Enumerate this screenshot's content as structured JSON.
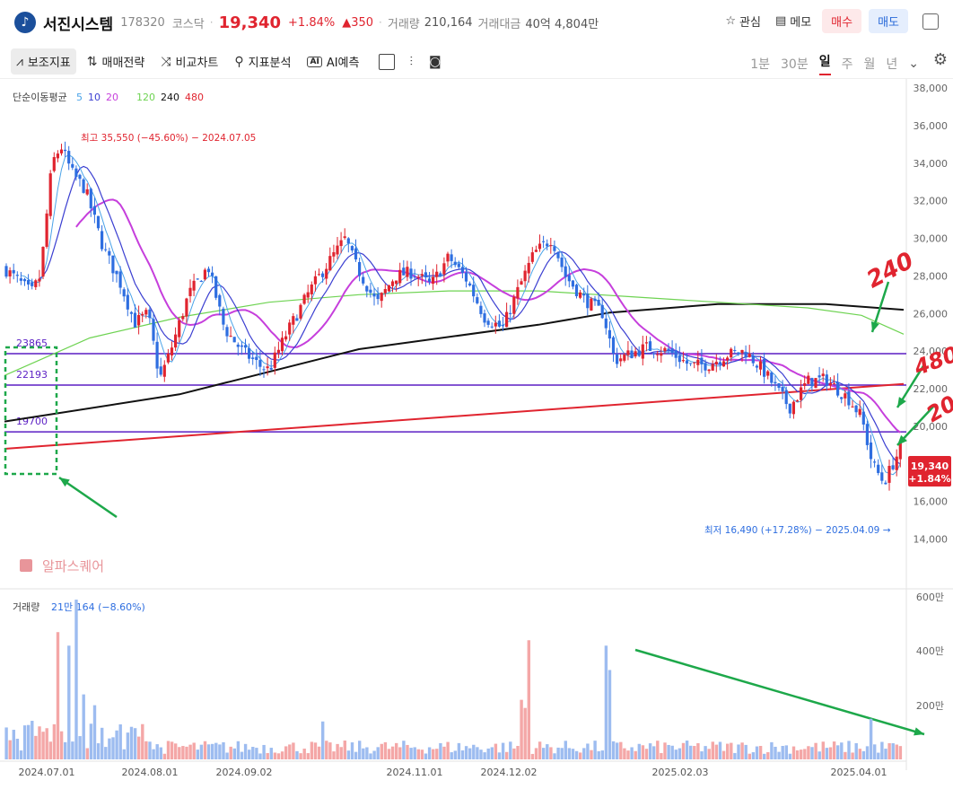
{
  "header": {
    "logo_text": "♪",
    "name": "서진시스템",
    "code": "178320",
    "market": "코스닥",
    "price": "19,340",
    "change_pct": "+1.84%",
    "change_abs": "▲350",
    "volume_label": "거래량",
    "volume": "210,164",
    "amount_label": "거래대금",
    "amount": "40억 4,804만",
    "watch_label": "관심",
    "memo_label": "메모",
    "buy_label": "매수",
    "sell_label": "매도"
  },
  "toolbar": {
    "indicator_label": "보조지표",
    "strategy_label": "매매전략",
    "compare_label": "비교차트",
    "analysis_label": "지표분석",
    "ai_label": "AI예측",
    "periods": [
      "1분",
      "30분",
      "일",
      "주",
      "월",
      "년"
    ],
    "active_period": "일"
  },
  "chart": {
    "ma_title": "단순이동평균",
    "ma_periods": [
      "5",
      "10",
      "20",
      "120",
      "240",
      "480"
    ],
    "ma_colors": [
      "#4aa3e8",
      "#3b3fd1",
      "#c63fdc",
      "#6ed352",
      "#111111",
      "#e0242f"
    ],
    "up_color": "#e0242f",
    "down_color": "#2e6ee0",
    "price_ticks": [
      "38,000",
      "36,000",
      "34,000",
      "32,000",
      "30,000",
      "28,000",
      "26,000",
      "24,000",
      "22,000",
      "20,000",
      "18,000",
      "16,000",
      "14,000"
    ],
    "current_price": "19,340",
    "current_change": "+1.84%",
    "high_label": "최고 35,550 (−45.60%) − 2024.07.05",
    "low_label": "최저 16,490 (+17.28%) − 2025.04.09 →",
    "hlines": [
      {
        "label": "23865",
        "value": 23865
      },
      {
        "label": "22193",
        "value": 22193
      },
      {
        "label": "19700",
        "value": 19700
      }
    ],
    "watermark": "알파스퀘어",
    "volume_title": "거래량",
    "volume_value": "21만 164 (−8.60%)",
    "volume_ticks": [
      "600만",
      "400만",
      "200만"
    ],
    "date_ticks": [
      "2024.07.01",
      "2024.08.01",
      "2024.09.02",
      "2024.11.01",
      "2024.12.02",
      "2025.02.03",
      "2025.04.01"
    ],
    "annotations": [
      "240",
      "480",
      "20"
    ]
  }
}
